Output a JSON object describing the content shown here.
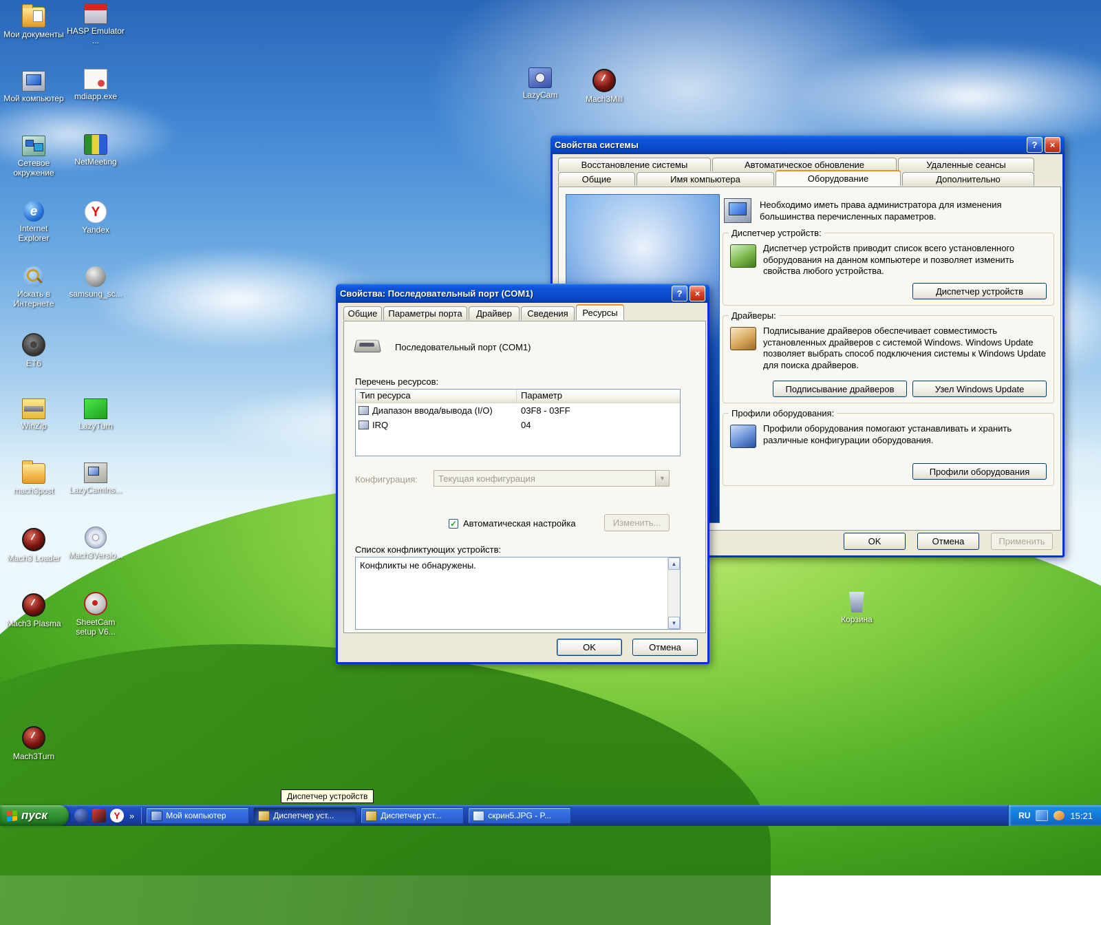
{
  "chrome": {
    "help": "?",
    "close": "×",
    "check": "✓",
    "arrow_down": "▼",
    "arrow_up": "▲"
  },
  "desktop": {
    "col1": [
      "Мои документы",
      "Мой компьютер",
      "Сетевое окружение",
      "Internet Explorer",
      "Искать в Интернете",
      "ET6",
      "WinZip",
      "mach3post",
      "Mach3 Loader",
      "Mach3 Plasma",
      "Mach3Turn"
    ],
    "col2": [
      "HASP Emulator ...",
      "mdiapp.exe",
      "NetMeeting",
      "Yandex",
      "samsung_sc...",
      "LazyTurn",
      "LazyCamIns...",
      "Mach3Versio...",
      "SheetCam setup V6..."
    ],
    "float": [
      "LazyCam",
      "Mach3Mill",
      "Корзина"
    ],
    "glyphs": {
      "ie": "e",
      "yandex": "Y"
    }
  },
  "sysprops": {
    "title": "Свойства системы",
    "tabs_row1": [
      "Восстановление системы",
      "Автоматическое обновление",
      "Удаленные сеансы"
    ],
    "tabs_row2": [
      "Общие",
      "Имя компьютера",
      "Оборудование",
      "Дополнительно"
    ],
    "admin_note": "Необходимо иметь права администратора для изменения большинства перечисленных параметров.",
    "device_manager": {
      "title": "Диспетчер устройств:",
      "text": "Диспетчер устройств приводит список всего установленного оборудования на данном компьютере и позволяет изменить свойства любого устройства.",
      "button": "Диспетчер устройств"
    },
    "drivers": {
      "title": "Драйверы:",
      "text": "Подписывание драйверов обеспечивает совместимость установленных драйверов с системой Windows.  Windows Update позволяет выбрать способ подключения системы к Windows Update для поиска драйверов.",
      "button_signing": "Подписывание драйверов",
      "button_wu": "Узел Windows Update"
    },
    "profiles": {
      "title": "Профили оборудования:",
      "text": "Профили оборудования помогают устанавливать и хранить различные конфигурации оборудования.",
      "button": "Профили оборудования"
    },
    "ok": "OK",
    "cancel": "Отмена",
    "apply": "Применить"
  },
  "comport": {
    "title": "Свойства: Последовательный порт (COM1)",
    "tabs": [
      "Общие",
      "Параметры порта",
      "Драйвер",
      "Сведения",
      "Ресурсы"
    ],
    "device_name": "Последовательный порт (COM1)",
    "resources_label": "Перечень ресурсов:",
    "table": {
      "headers": [
        "Тип ресурса",
        "Параметр"
      ],
      "rows": [
        [
          "Диапазон ввода/вывода (I/O)",
          "03F8 - 03FF"
        ],
        [
          "IRQ",
          "04"
        ]
      ]
    },
    "config_label": "Конфигурация:",
    "config_value": "Текущая конфигурация",
    "auto_label": "Автоматическая настройка",
    "change_button": "Изменить...",
    "conflicts_label": "Список конфликтующих устройств:",
    "conflicts_text": "Конфликты не обнаружены.",
    "ok": "OK",
    "cancel": "Отмена"
  },
  "taskbar": {
    "start": "пуск",
    "overflow": "»",
    "tasks": [
      "Мой компьютер",
      "Диспетчер уст...",
      "Диспетчер уст...",
      "скрин5.JPG - P..."
    ],
    "tray": {
      "lang": "RU",
      "time": "15:21"
    },
    "tooltip": "Диспетчер устройств"
  }
}
